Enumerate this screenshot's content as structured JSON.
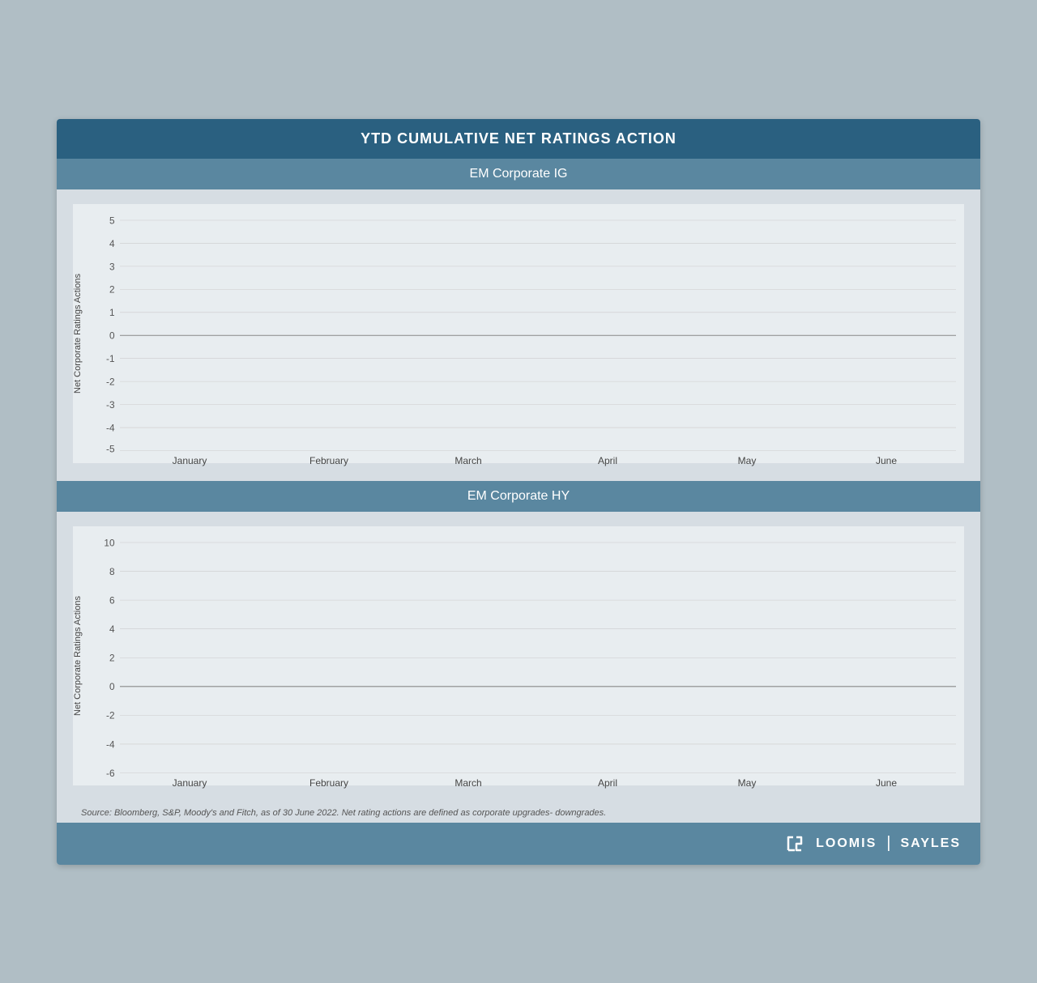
{
  "title": "YTD CUMULATIVE NET RATINGS ACTION",
  "chart1": {
    "header": "EM Corporate IG",
    "yAxisLabel": "Net Corporate Ratings Actions",
    "yTicks": [
      "5",
      "4",
      "3",
      "2",
      "1",
      "0",
      "-1",
      "-2",
      "-3",
      "-4",
      "-5"
    ],
    "yMin": -5,
    "yMax": 5,
    "xLabels": [
      "January",
      "February",
      "March",
      "April",
      "May",
      "June"
    ]
  },
  "chart2": {
    "header": "EM Corporate HY",
    "yAxisLabel": "Net Corporate Ratings Actions",
    "yTicks": [
      "10",
      "8",
      "6",
      "4",
      "2",
      "0",
      "-2",
      "-4",
      "-6"
    ],
    "yMin": -6,
    "yMax": 10,
    "xLabels": [
      "January",
      "February",
      "March",
      "April",
      "May",
      "June"
    ]
  },
  "footer": {
    "source": "Source: Bloomberg, S&P, Moody's and Fitch, as of 30 June 2022. Net rating actions are defined as corporate upgrades- downgrades."
  },
  "logo": {
    "brand1": "LOOMIS",
    "brand2": "SAYLES"
  }
}
